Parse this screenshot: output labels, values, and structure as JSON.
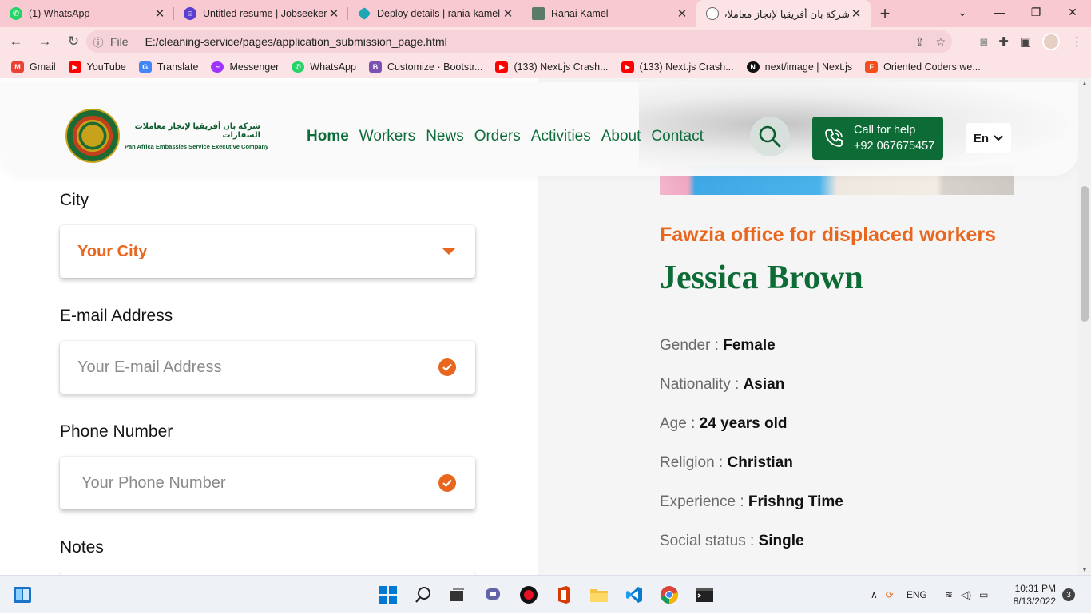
{
  "browser": {
    "tabs": [
      {
        "title": "(1) WhatsApp",
        "icon": "whatsapp-icon",
        "color": "#25d366"
      },
      {
        "title": "Untitled resume | Jobseeker",
        "icon": "jobseeker-icon",
        "color": "#5b3fd1"
      },
      {
        "title": "Deploy details | rania-kamel-",
        "icon": "netlify-icon",
        "color": "#20a7b5"
      },
      {
        "title": "Ranai Kamel",
        "icon": "page-icon",
        "color": "#5a7a6a"
      },
      {
        "title": "شركة بان أفريقيا لإنجاز معاملات",
        "icon": "globe-icon",
        "color": "#666666"
      }
    ],
    "new_tab": "+",
    "window_controls": [
      "⌄",
      "—",
      "❐",
      "✕"
    ],
    "address": {
      "scheme_label": "File",
      "url": "E:/cleaning-service/pages/application_submission_page.html"
    },
    "bookmarks": [
      {
        "label": "Gmail",
        "color": "#ea4335"
      },
      {
        "label": "YouTube",
        "color": "#ff0000"
      },
      {
        "label": "Translate",
        "color": "#4285f4"
      },
      {
        "label": "Messenger",
        "color": "#a033ff"
      },
      {
        "label": "WhatsApp",
        "color": "#25d366"
      },
      {
        "label": "Customize · Bootstr...",
        "color": "#7952b3"
      },
      {
        "label": "(133) Next.js Crash...",
        "color": "#ff0000"
      },
      {
        "label": "(133) Next.js Crash...",
        "color": "#ff0000"
      },
      {
        "label": "next/image | Next.js",
        "color": "#111111"
      },
      {
        "label": "Oriented Coders we...",
        "color": "#f24e1e"
      }
    ]
  },
  "site": {
    "logo": {
      "arabic": "شركة بان أفريقيا لإنجاز معاملات السفارات",
      "english": "Pan Africa Embassies Service Executive Company"
    },
    "nav": [
      "Home",
      "Workers",
      "News",
      "Orders",
      "Activities",
      "About",
      "Contact"
    ],
    "help": {
      "label": "Call for help",
      "phone": "+92 067675457"
    },
    "language": "En"
  },
  "form": {
    "city": {
      "label": "City",
      "value": "Your City"
    },
    "email": {
      "label": "E-mail Address",
      "placeholder": "Your E-mail Address"
    },
    "phone": {
      "label": "Phone Number",
      "placeholder": "Your Phone Number"
    },
    "notes": {
      "label": "Notes"
    }
  },
  "worker": {
    "office": "Fawzia office for displaced workers",
    "name": "Jessica Brown",
    "details": [
      {
        "label": "Gender :",
        "value": "Female"
      },
      {
        "label": "Nationality :",
        "value": "Asian"
      },
      {
        "label": "Age :",
        "value": "24 years old"
      },
      {
        "label": "Religion :",
        "value": "Christian"
      },
      {
        "label": "Experience :",
        "value": "Frishng Time"
      },
      {
        "label": "Social status :",
        "value": "Single"
      }
    ]
  },
  "taskbar": {
    "language": "ENG",
    "time": "10:31 PM",
    "date": "8/13/2022",
    "notifications": "3"
  },
  "colors": {
    "brand_green": "#0d6b35",
    "accent_orange": "#e8661e",
    "chrome_pink": "#f8c9d0"
  }
}
